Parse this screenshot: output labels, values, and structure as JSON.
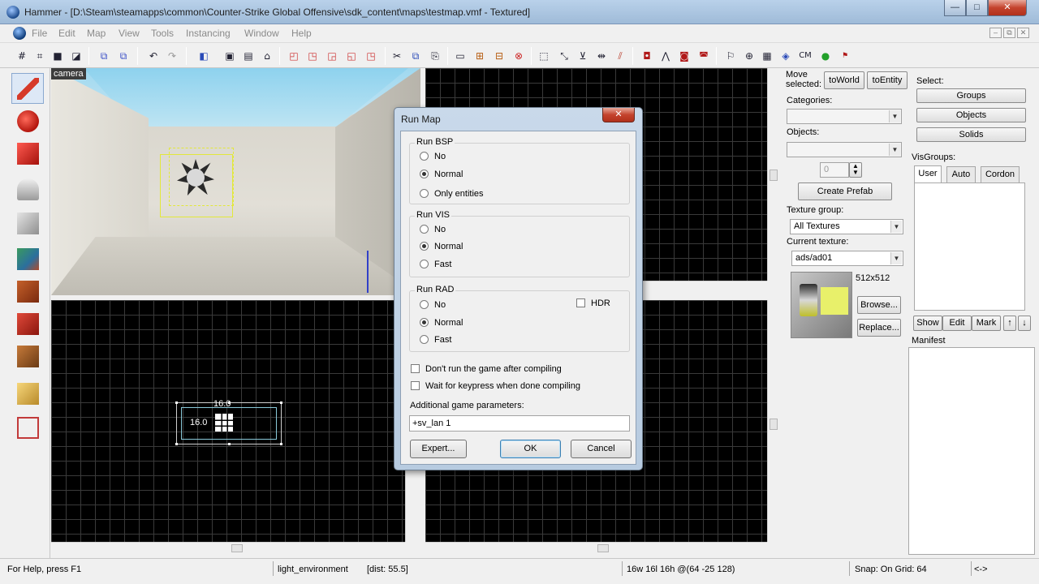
{
  "window": {
    "title": "Hammer - [D:\\Steam\\steamapps\\common\\Counter-Strike Global Offensive\\sdk_content\\maps\\testmap.vmf - Textured]",
    "controls": {
      "minimize": "—",
      "maximize": "□",
      "close": "✕"
    }
  },
  "menu": {
    "items": [
      "File",
      "Edit",
      "Map",
      "View",
      "Tools",
      "Instancing",
      "Window",
      "Help"
    ],
    "mdi_controls": [
      "–",
      "⧉",
      "✕"
    ]
  },
  "toolbar": {
    "icons": [
      "grid-icon",
      "grid-lower-icon",
      "grid-square-icon",
      "grid-move-icon",
      "hide-icon",
      "show-icon",
      "undo-icon",
      "redo-icon",
      "carve-icon",
      "group-icon",
      "ungroup-icon",
      "cordon-icon",
      "hollow-icon",
      "texture-lock-icon",
      "cut-icon",
      "copy-icon",
      "paste-icon",
      "select-icon",
      "scale-icon",
      "align-icon",
      "flip-icon",
      "vertex-icon",
      "entity-icon",
      "decal-icon",
      "overlay-icon",
      "clip-icon",
      "path-icon",
      "run-icon",
      "models-icon",
      "cm-icon",
      "compile-icon"
    ],
    "text_buttons": [
      "CM"
    ]
  },
  "camera": {
    "label": "camera"
  },
  "views": {
    "bottom_left": {
      "width_label": "16.0",
      "height_label": "16.0"
    }
  },
  "right_panel": {
    "move_selected": "Move selected:",
    "to_world": "toWorld",
    "to_entity": "toEntity",
    "select_label": "Select:",
    "groups": "Groups",
    "objects_btn": "Objects",
    "solids": "Solids",
    "categories_label": "Categories:",
    "objects_label": "Objects:",
    "spinner_value": "0",
    "create_prefab": "Create Prefab",
    "visgroups_label": "VisGroups:",
    "tabs": [
      "User",
      "Auto",
      "Cordon"
    ],
    "texture_group_label": "Texture group:",
    "texture_group_value": "All Textures",
    "current_texture_label": "Current texture:",
    "current_texture_value": "ads/ad01",
    "texture_size": "512x512",
    "browse": "Browse...",
    "replace": "Replace...",
    "show": "Show",
    "edit": "Edit",
    "mark": "Mark",
    "manifest_label": "Manifest"
  },
  "status": {
    "help": "For Help, press F1",
    "selection": "light_environment",
    "dist": "[dist: 55.5]",
    "size": "16w 16l 16h @(64 -25 128)",
    "snap": "Snap: On Grid: 64",
    "extra": "<->"
  },
  "dialog": {
    "title": "Run Map",
    "close": "✕",
    "bsp": {
      "label": "Run BSP",
      "options": [
        "No",
        "Normal",
        "Only entities"
      ],
      "selected": 1
    },
    "vis": {
      "label": "Run VIS",
      "options": [
        "No",
        "Normal",
        "Fast"
      ],
      "selected": 1
    },
    "rad": {
      "label": "Run RAD",
      "options": [
        "No",
        "Normal",
        "Fast"
      ],
      "selected": 1,
      "hdr_label": "HDR"
    },
    "dont_run_label": "Don't run the game after compiling",
    "wait_label": "Wait for keypress when done compiling",
    "params_label": "Additional game parameters:",
    "params_value": "+sv_lan 1",
    "expert": "Expert...",
    "ok": "OK",
    "cancel": "Cancel"
  }
}
